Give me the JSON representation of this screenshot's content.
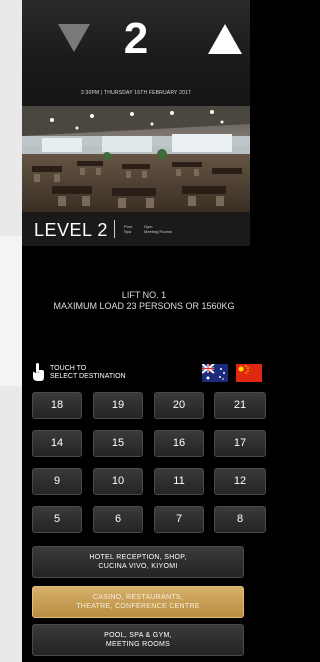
{
  "header": {
    "floor": "2",
    "datetime": "2:30PM | THURSDAY 16TH FEBRUARY 2017"
  },
  "level_bar": {
    "level": "LEVEL 2",
    "col1": [
      "Pool",
      "Spa"
    ],
    "col2": [
      "Gym",
      "Meeting Rooms"
    ]
  },
  "lift": {
    "line1": "LIFT NO. 1",
    "line2": "MAXIMUM LOAD 23 PERSONS OR 1560KG"
  },
  "touch": {
    "line1": "TOUCH TO",
    "line2": "SELECT DESTINATION"
  },
  "floors": [
    "18",
    "19",
    "20",
    "21",
    "14",
    "15",
    "16",
    "17",
    "9",
    "10",
    "11",
    "12",
    "5",
    "6",
    "7",
    "8"
  ],
  "destinations": [
    {
      "line1": "HOTEL RECEPTION, SHOP,",
      "line2": "CUCINA VIVO, KIYOMI"
    },
    {
      "line1": "CASINO, RESTAURANTS,",
      "line2": "THEATRE, CONFERENCE CENTRE"
    },
    {
      "line1": "POOL, SPA & GYM,",
      "line2": "MEETING ROOMS"
    }
  ],
  "colors": {
    "background": "#000000",
    "gold_button": "#c79e55",
    "side_panel": "#e9e9e9"
  },
  "icons": [
    "arrow-down-icon",
    "arrow-up-icon",
    "hand-pointer-icon",
    "australia-flag-icon",
    "china-flag-icon"
  ]
}
